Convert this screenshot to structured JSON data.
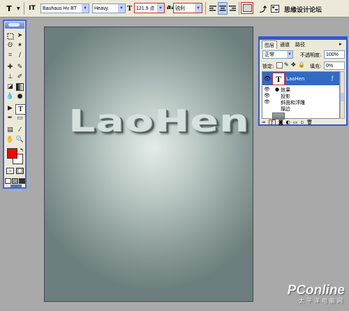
{
  "options_bar": {
    "tool_icon_label": "T",
    "orient_icon_label": "IT",
    "font_family": "Bauhaus Hv BT",
    "font_style": "Heavy",
    "size_icon_label": "T",
    "font_size": "121.9 点",
    "aa_icon_label": "a",
    "antialias": "锐利",
    "hl_color": "#e0261b"
  },
  "toolbox": {
    "foreground_color": "#ff0000",
    "background_color": "#ffffff",
    "selected_tool": "text-tool"
  },
  "canvas": {
    "text": "LaoHen"
  },
  "layers_panel": {
    "tabs": [
      "图层",
      "通道",
      "路径"
    ],
    "blend_mode": "正常",
    "opacity_label": "不透明度:",
    "opacity_value": "100%",
    "lock_label": "锁定:",
    "fill_label": "填充:",
    "fill_value": "0%",
    "layer_name": "LaoHen",
    "layer_thumb_label": "T",
    "effects_label": "效果",
    "effects": [
      "投影",
      "斜面和浮雕",
      "描边"
    ],
    "selected_color": "#316ac5"
  },
  "watermark": {
    "brand": "PConline",
    "slogan": "太平洋电脑网",
    "site_text": "思缘设计论坛"
  }
}
